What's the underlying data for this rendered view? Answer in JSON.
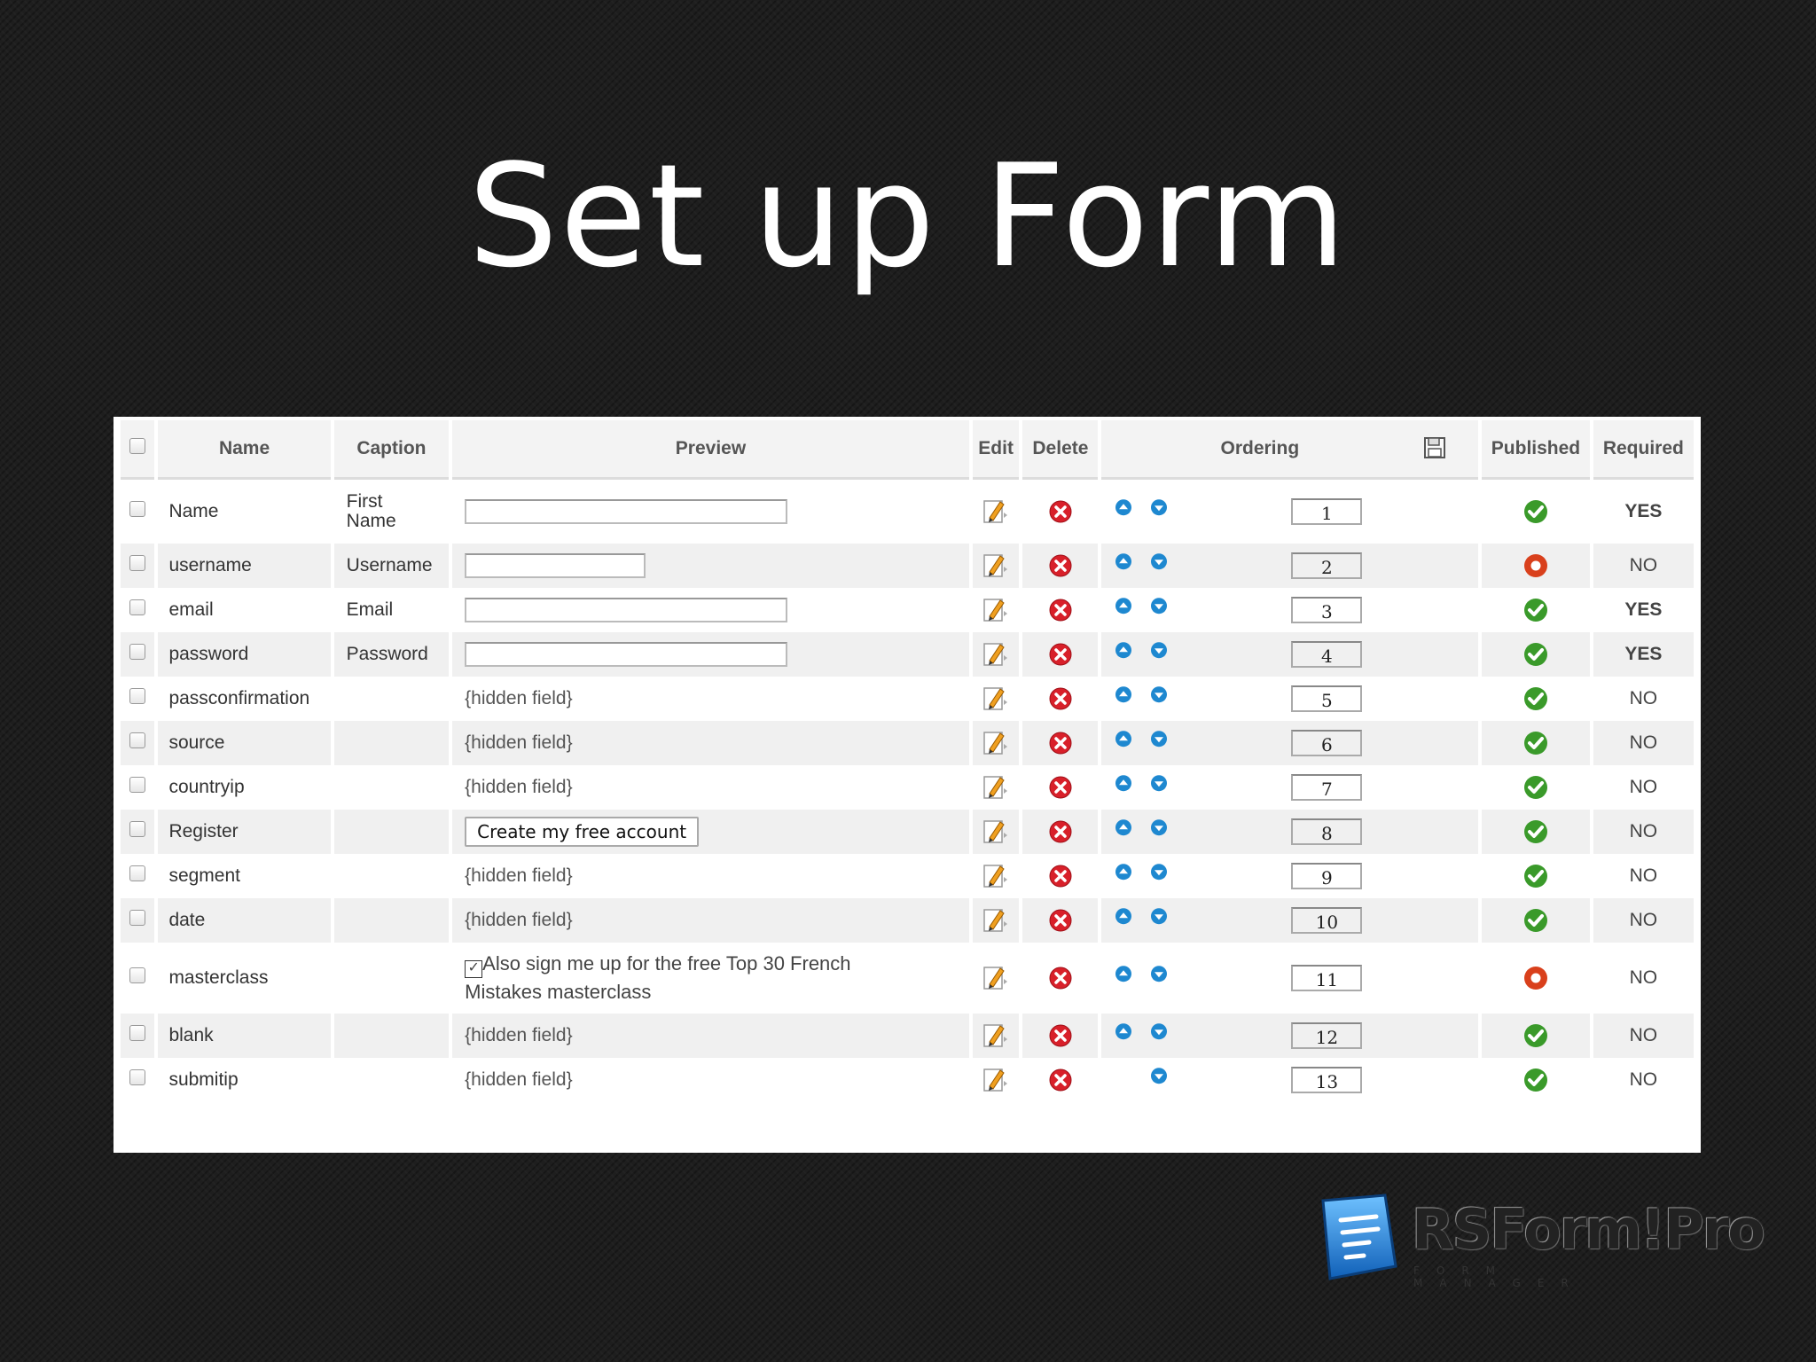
{
  "slide": {
    "title": "Set up Form"
  },
  "table": {
    "headers": {
      "name": "Name",
      "caption": "Caption",
      "preview": "Preview",
      "edit": "Edit",
      "delete": "Delete",
      "ordering": "Ordering",
      "published": "Published",
      "required": "Required"
    },
    "rows": [
      {
        "name": "Name",
        "caption": "First Name",
        "preview_type": "input",
        "order": "1",
        "published": true,
        "required": "YES"
      },
      {
        "name": "username",
        "caption": "Username",
        "preview_type": "input-short",
        "order": "2",
        "published": false,
        "required": "NO"
      },
      {
        "name": "email",
        "caption": "Email",
        "preview_type": "input",
        "order": "3",
        "published": true,
        "required": "YES"
      },
      {
        "name": "password",
        "caption": "Password",
        "preview_type": "input",
        "order": "4",
        "published": true,
        "required": "YES"
      },
      {
        "name": "passconfirmation",
        "caption": "",
        "preview": "{hidden field}",
        "order": "5",
        "published": true,
        "required": "NO"
      },
      {
        "name": "source",
        "caption": "",
        "preview": "{hidden field}",
        "order": "6",
        "published": true,
        "required": "NO"
      },
      {
        "name": "countryip",
        "caption": "",
        "preview": "{hidden field}",
        "order": "7",
        "published": true,
        "required": "NO"
      },
      {
        "name": "Register",
        "caption": "",
        "preview_button": "Create my free account",
        "order": "8",
        "published": true,
        "required": "NO"
      },
      {
        "name": "segment",
        "caption": "",
        "preview": "{hidden field}",
        "order": "9",
        "published": true,
        "required": "NO"
      },
      {
        "name": "date",
        "caption": "",
        "preview": "{hidden field}",
        "order": "10",
        "published": true,
        "required": "NO"
      },
      {
        "name": "masterclass",
        "caption": "",
        "preview_checkbox": "Also sign me up for the free Top 30 French Mistakes masterclass",
        "order": "11",
        "published": false,
        "required": "NO"
      },
      {
        "name": "blank",
        "caption": "",
        "preview": "{hidden field}",
        "order": "12",
        "published": true,
        "required": "NO"
      },
      {
        "name": "submitip",
        "caption": "",
        "preview": "{hidden field}",
        "order": "13",
        "published": true,
        "required": "NO"
      }
    ]
  },
  "logo": {
    "name": "RSForm!Pro",
    "tagline": "FORM MANAGER"
  },
  "colors": {
    "published": "#3a9a2a",
    "unpublished": "#d9401c",
    "delete": "#d8202a",
    "arrow": "#1e88d0"
  },
  "icons": {
    "edit": "pencil-icon",
    "delete": "delete-icon",
    "up": "arrow-up-icon",
    "down": "arrow-down-icon",
    "save": "save-icon",
    "published": "check-circle-icon",
    "unpublished": "unpublished-icon"
  }
}
